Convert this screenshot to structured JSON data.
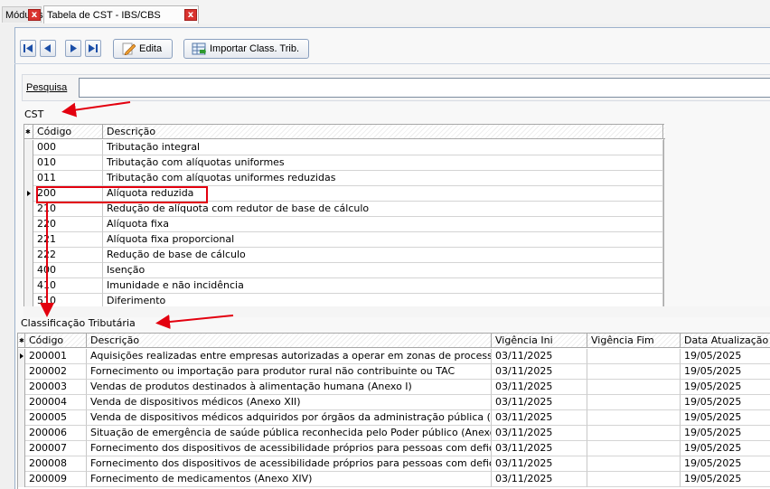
{
  "tabs": [
    {
      "label": "Módulos"
    },
    {
      "label": "Tabela de CST - IBS/CBS"
    }
  ],
  "toolbar": {
    "edit_label": "Edita",
    "import_label": "Importar Class. Trib."
  },
  "search": {
    "label": "Pesquisa",
    "value": ""
  },
  "cst": {
    "title": "CST",
    "columns": [
      "Código",
      "Descrição"
    ],
    "rows": [
      {
        "code": "000",
        "desc": "Tributação integral"
      },
      {
        "code": "010",
        "desc": "Tributação com alíquotas uniformes"
      },
      {
        "code": "011",
        "desc": "Tributação com alíquotas uniformes reduzidas"
      },
      {
        "code": "200",
        "desc": "Alíquota reduzida"
      },
      {
        "code": "210",
        "desc": "Redução de alíquota com redutor de base de cálculo"
      },
      {
        "code": "220",
        "desc": "Alíquota fixa"
      },
      {
        "code": "221",
        "desc": "Alíquota fixa proporcional"
      },
      {
        "code": "222",
        "desc": "Redução de base de cálculo"
      },
      {
        "code": "400",
        "desc": "Isenção"
      },
      {
        "code": "410",
        "desc": "Imunidade e não incidência"
      },
      {
        "code": "510",
        "desc": "Diferimento"
      }
    ]
  },
  "class": {
    "title": "Classificação Tributária",
    "columns": [
      "Código",
      "Descrição",
      "Vigência Ini",
      "Vigência Fim",
      "Data Atualização"
    ],
    "rows": [
      {
        "code": "200001",
        "desc": "Aquisições realizadas entre empresas autorizadas a operar em zonas de processamento",
        "ini": "03/11/2025",
        "fim": "",
        "upd": "19/05/2025"
      },
      {
        "code": "200002",
        "desc": "Fornecimento ou importação para produtor rural não contribuinte ou TAC",
        "ini": "03/11/2025",
        "fim": "",
        "upd": "19/05/2025"
      },
      {
        "code": "200003",
        "desc": "Vendas de produtos destinados à alimentação humana (Anexo I)",
        "ini": "03/11/2025",
        "fim": "",
        "upd": "19/05/2025"
      },
      {
        "code": "200004",
        "desc": "Venda de dispositivos médicos (Anexo XII)",
        "ini": "03/11/2025",
        "fim": "",
        "upd": "19/05/2025"
      },
      {
        "code": "200005",
        "desc": "Venda de dispositivos médicos adquiridos por órgãos da administração pública (Anexo",
        "ini": "03/11/2025",
        "fim": "",
        "upd": "19/05/2025"
      },
      {
        "code": "200006",
        "desc": "Situação de emergência de saúde pública reconhecida pelo Poder público (Anexo XII)",
        "ini": "03/11/2025",
        "fim": "",
        "upd": "19/05/2025"
      },
      {
        "code": "200007",
        "desc": "Fornecimento dos dispositivos de acessibilidade próprios para pessoas com deficiência",
        "ini": "03/11/2025",
        "fim": "",
        "upd": "19/05/2025"
      },
      {
        "code": "200008",
        "desc": "Fornecimento dos dispositivos de acessibilidade próprios para pessoas com deficiência",
        "ini": "03/11/2025",
        "fim": "",
        "upd": "19/05/2025"
      },
      {
        "code": "200009",
        "desc": "Fornecimento de medicamentos (Anexo XIV)",
        "ini": "03/11/2025",
        "fim": "",
        "upd": "19/05/2025"
      }
    ]
  },
  "colors": {
    "annotation_red": "#e3000f",
    "close_red": "#d9322e"
  }
}
